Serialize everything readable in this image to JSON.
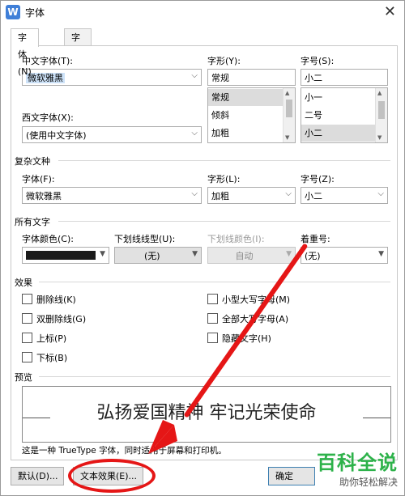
{
  "window": {
    "title": "字体"
  },
  "tabs": [
    {
      "label": "字体(N)"
    },
    {
      "label": "字符间距(R)"
    }
  ],
  "font": {
    "cn_label": "中文字体(T):",
    "cn_value": "微软雅黑",
    "style_label": "字形(Y):",
    "style_value": "常规",
    "style_options": [
      "常规",
      "倾斜",
      "加粗"
    ],
    "size_label": "字号(S):",
    "size_value": "小二",
    "size_options": [
      "小一",
      "二号",
      "小二"
    ],
    "west_label": "西文字体(X):",
    "west_value": "(使用中文字体)"
  },
  "complex": {
    "section": "复杂文种",
    "font_label": "字体(F):",
    "font_value": "微软雅黑",
    "style_label": "字形(L):",
    "style_value": "加粗",
    "size_label": "字号(Z):",
    "size_value": "小二"
  },
  "all_text": {
    "section": "所有文字",
    "color_label": "字体颜色(C):",
    "color_value": "#1a1a1a",
    "underline_label": "下划线线型(U):",
    "underline_value": "(无)",
    "underline_color_label": "下划线颜色(I):",
    "underline_color_value": "自动",
    "emphasis_label": "着重号:",
    "emphasis_value": "(无)"
  },
  "effects": {
    "section": "效果",
    "left": [
      "删除线(K)",
      "双删除线(G)",
      "上标(P)",
      "下标(B)"
    ],
    "right": [
      "小型大写字母(M)",
      "全部大写字母(A)",
      "隐藏文字(H)"
    ]
  },
  "preview": {
    "section": "预览",
    "sample": "弘扬爱国精神  牢记光荣使命",
    "note": "这是一种 TrueType 字体，同时适用于屏幕和打印机。"
  },
  "buttons": {
    "default": "默认(D)...",
    "text_effect": "文本效果(E)...",
    "ok": "确定"
  },
  "watermark": {
    "brand": "百科全说",
    "tagline": "助你轻松解决"
  }
}
